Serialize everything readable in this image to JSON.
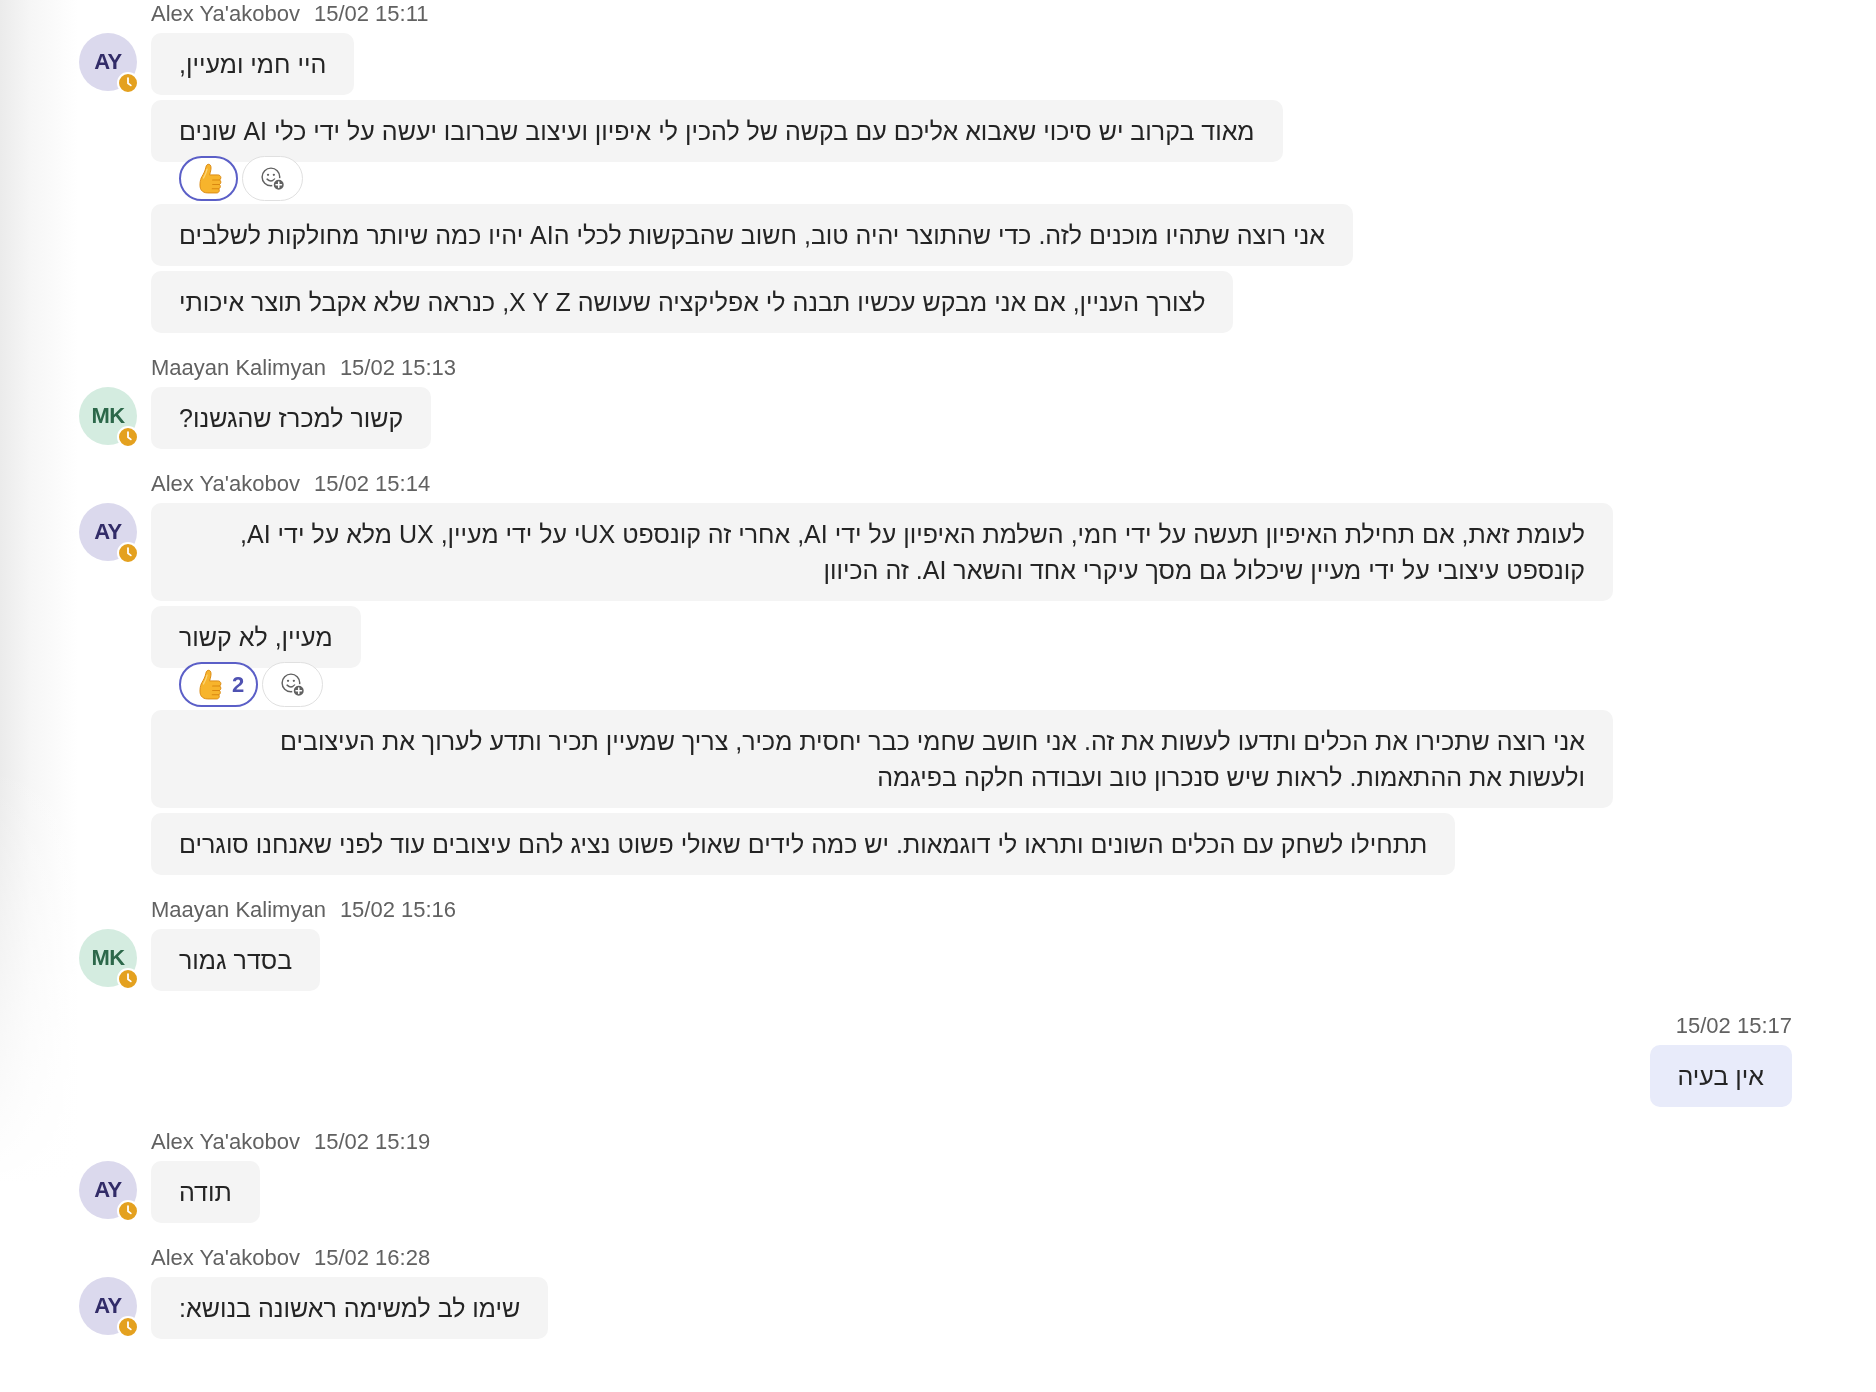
{
  "messages": [
    {
      "kind": "incoming",
      "sender": "Alex Ya'akobov",
      "time": "15/02 15:11",
      "avatar": {
        "initials": "AY",
        "color": "#dbd9ed",
        "away": true
      },
      "bubbles": [
        {
          "text": "היי חמי ומעיין,"
        },
        {
          "text": "מאוד בקרוב יש סיכוי שאבוא אליכם עם בקשה של להכין לי איפיון ועיצוב שברובו יעשה על ידי כלי AI שונים",
          "reactions": [
            {
              "kind": "like",
              "selected": true
            }
          ]
        },
        {
          "text": "אני רוצה שתהיו מוכנים לזה. כדי שהתוצר יהיה טוב, חשוב שהבקשות לכלי הAI יהיו כמה שיותר מחולקות לשלבים"
        },
        {
          "text": "לצורך העניין, אם אני מבקש עכשיו תבנה לי אפליקציה שעושה X Y Z, כנראה שלא אקבל תוצר איכותי"
        }
      ]
    },
    {
      "kind": "incoming",
      "sender": "Maayan Kalimyan",
      "time": "15/02 15:13",
      "avatar": {
        "initials": "MK",
        "color": "#d4ece0",
        "away": true
      },
      "bubbles": [
        {
          "text": "קשור למכרז שהגשנו?"
        }
      ]
    },
    {
      "kind": "incoming",
      "sender": "Alex Ya'akobov",
      "time": "15/02 15:14",
      "avatar": {
        "initials": "AY",
        "color": "#dbd9ed",
        "away": true
      },
      "bubbles": [
        {
          "text": "לעומת זאת, אם תחילת האיפיון תעשה על ידי חמי, השלמת האיפיון על ידי AI, אחרי זה קונספט UXי על ידי מעיין, UX מלא על ידי AI, קונספט עיצובי על ידי מעיין שיכלול גם מסך עיקרי אחד והשאר AI. זה הכיוון"
        },
        {
          "text": "מעיין, לא קשור",
          "reactions": [
            {
              "kind": "like",
              "count": "2",
              "selected": true
            }
          ]
        },
        {
          "text": "אני רוצה שתכירו את הכלים ותדעו לעשות את זה. אני חושב שחמי כבר יחסית מכיר, צריך שמעיין תכיר ותדע לערוך את העיצובים ולעשות את ההתאמות. לראות שיש סנכרון טוב ועבודה חלקה בפיגמה"
        },
        {
          "text": "תתחילו לשחק עם הכלים השונים ותראו לי דוגמאות. יש כמה לידים שאולי פשוט נציג להם עיצובים עוד לפני שאנחנו סוגרים"
        }
      ]
    },
    {
      "kind": "incoming",
      "sender": "Maayan Kalimyan",
      "time": "15/02 15:16",
      "avatar": {
        "initials": "MK",
        "color": "#d4ece0",
        "away": true
      },
      "bubbles": [
        {
          "text": "בסדר גמור"
        }
      ]
    },
    {
      "kind": "outgoing",
      "time": "15/02 15:17",
      "bubbles": [
        {
          "text": "אין בעיה"
        }
      ]
    },
    {
      "kind": "incoming",
      "sender": "Alex Ya'akobov",
      "time": "15/02 15:19",
      "avatar": {
        "initials": "AY",
        "color": "#dbd9ed",
        "away": true
      },
      "bubbles": [
        {
          "text": "תודה"
        }
      ]
    },
    {
      "kind": "incoming",
      "sender": "Alex Ya'akobov",
      "time": "15/02 16:28",
      "avatar": {
        "initials": "AY",
        "color": "#dbd9ed",
        "away": true
      },
      "bubbles": [
        {
          "text": "שימו לב למשימה ראשונה בנושא:"
        }
      ]
    }
  ]
}
